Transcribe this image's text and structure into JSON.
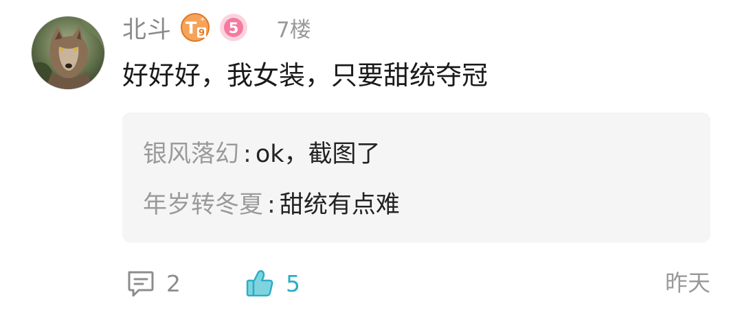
{
  "comment": {
    "username": "北斗",
    "floor": "7楼",
    "content": "好好好，我女装，只要甜统夺冠",
    "badges": [
      {
        "name": "tier-badge",
        "letter": "T",
        "digit": "9",
        "color": "#f08a2c"
      },
      {
        "name": "level-badge",
        "digit": "5",
        "color": "#f47aa0"
      }
    ]
  },
  "replies": [
    {
      "user": "银风落幻",
      "sep": ":",
      "text": "ok，截图了"
    },
    {
      "user": "年岁转冬夏",
      "sep": ":",
      "text": "甜统有点难"
    }
  ],
  "footer": {
    "reply_count": "2",
    "like_count": "5",
    "time": "昨天"
  },
  "colors": {
    "accent": "#2aaec4",
    "reply_bg": "#f5f5f5",
    "muted_text": "#9a9a9a"
  }
}
